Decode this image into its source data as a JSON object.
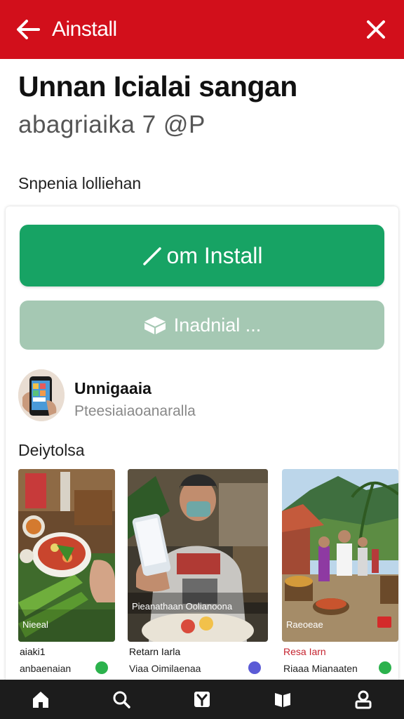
{
  "header": {
    "title": "Ainstall",
    "back_icon": "arrow-left-icon",
    "close_icon": "close-icon",
    "color": "#d20f1b"
  },
  "app": {
    "title": "Unnan Icialai sangan",
    "subtitle": "abagriaika 7 @P"
  },
  "section_label": "Snpenia lolliehan",
  "buttons": {
    "install_label": "om Install",
    "install_color": "#17a364",
    "secondary_label": "Inadnial ...",
    "secondary_color": "#a5c8b3"
  },
  "developer": {
    "name": "Unnigaaia",
    "subtitle": "Pteesiaiaoanaralla"
  },
  "gallery": {
    "label": "Deiytolsa",
    "items": [
      {
        "caption": "Nieeal",
        "title": "aiaki1",
        "subtitle": "anbaenaian",
        "badge_color": "#2bb24c"
      },
      {
        "caption": "Pieanathaan Oolianoona",
        "title": "Retarn Iarla",
        "subtitle": "Viaa Oimilaenaa",
        "badge_color": "#5b5bd6"
      },
      {
        "caption": "Raeoeae",
        "title": "Resa Iarn",
        "subtitle": "Riaaa Mianaaten",
        "badge_color": "#2bb24c"
      }
    ]
  },
  "bottom_nav": [
    {
      "name": "home-icon"
    },
    {
      "name": "search-icon"
    },
    {
      "name": "store-icon"
    },
    {
      "name": "library-icon"
    },
    {
      "name": "profile-icon"
    }
  ]
}
